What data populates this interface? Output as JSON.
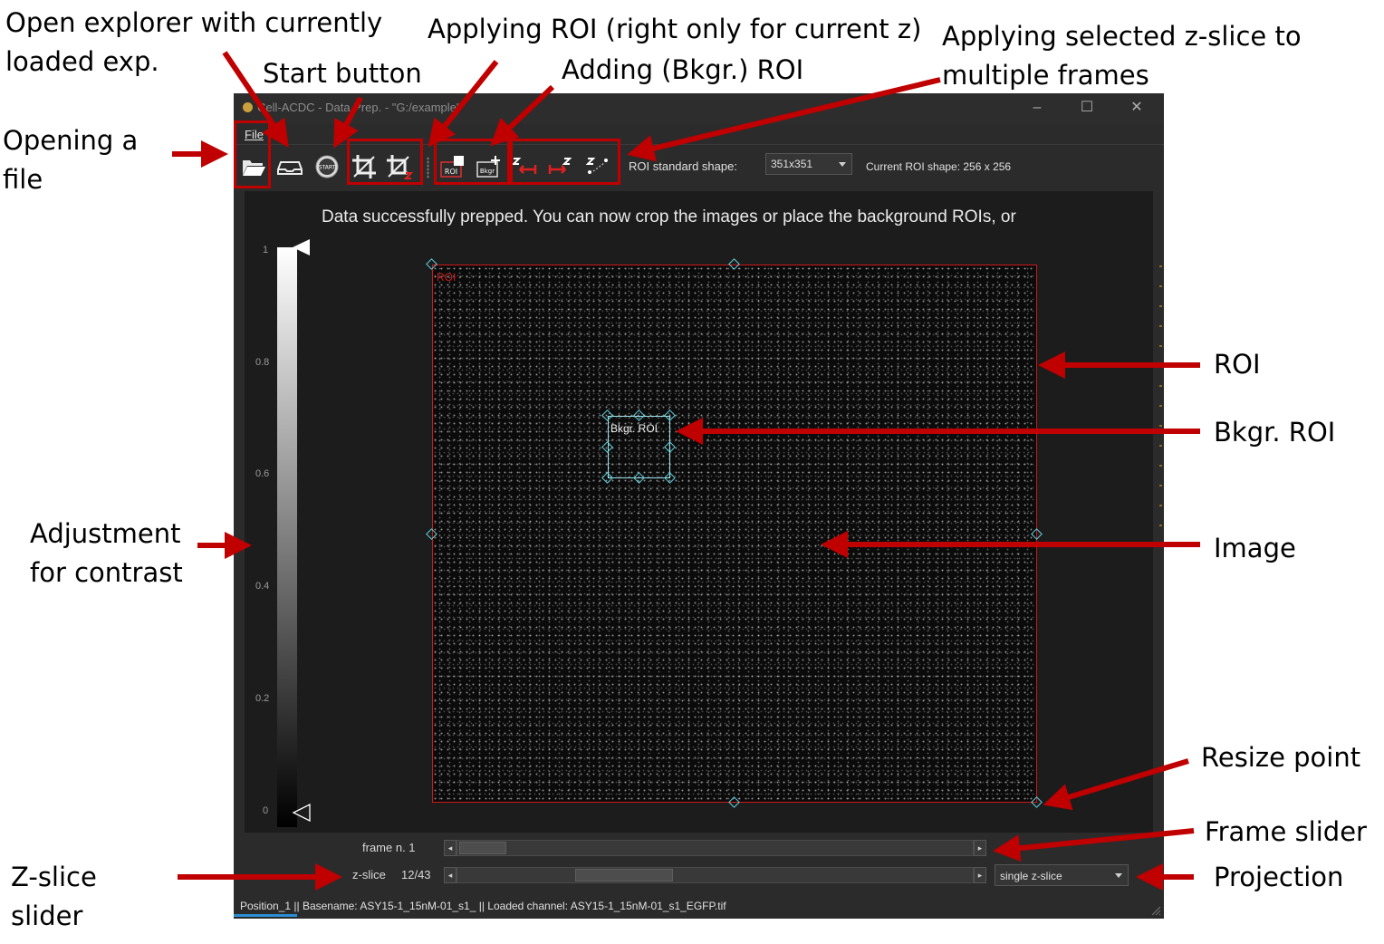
{
  "annotations": {
    "open_explorer": "Open explorer with currently\nloaded exp.",
    "start_button": "Start button",
    "applying_roi": "Applying ROI (right only for current z)",
    "adding_roi": "Adding (Bkgr.) ROI",
    "applying_zslice": "Applying selected z-slice to\nmultiple frames",
    "opening_file": "Opening a\nfile",
    "roi": "ROI",
    "bkgr_roi": "Bkgr. ROI",
    "image": "Image",
    "contrast": "Adjustment\nfor contrast",
    "resize_point": "Resize point",
    "frame_slider": "Frame slider",
    "projection": "Projection",
    "zslice_slider": "Z-slice\nslider"
  },
  "window": {
    "title": "Cell-ACDC - Data Prep. - \"G:/example\"",
    "minimize": "–",
    "maximize": "☐",
    "close": "✕"
  },
  "menu": {
    "file": "File"
  },
  "toolbar": {
    "open_icon": "folder-open-icon",
    "explorer_icon": "explorer-icon",
    "start_label": "START",
    "crop_icon": "crop-icon",
    "crop_z_icon": "crop-z-icon",
    "add_roi_label": "ROI",
    "add_bkgr_label": "Bkgr",
    "roi_shape_label": "ROI standard shape:",
    "roi_shape_value": "351x351",
    "current_roi_shape": "Current ROI shape: 256 x 256"
  },
  "viewer": {
    "message": "Data successfully prepped. You can now crop the images or place the background ROIs, or",
    "roi_label": "ROI",
    "bkgr_roi_label": "Bkgr. ROI",
    "colorbar_ticks": [
      "1",
      "0.8",
      "0.6",
      "0.4",
      "0.2",
      "0"
    ]
  },
  "sliders": {
    "frame_label": "frame n. 1",
    "zslice_label": "z-slice",
    "zslice_value": "12/43",
    "zslice_position": 0.28,
    "projection_value": "single z-slice"
  },
  "status": "Position_1 || Basename: ASY15-1_15nM-01_s1_ || Loaded channel: ASY15-1_15nM-01_s1_EGFP.tif",
  "colors": {
    "annotation_red": "#c00000",
    "roi_red": "#d01818",
    "handle_cyan": "#5ed4e0"
  }
}
